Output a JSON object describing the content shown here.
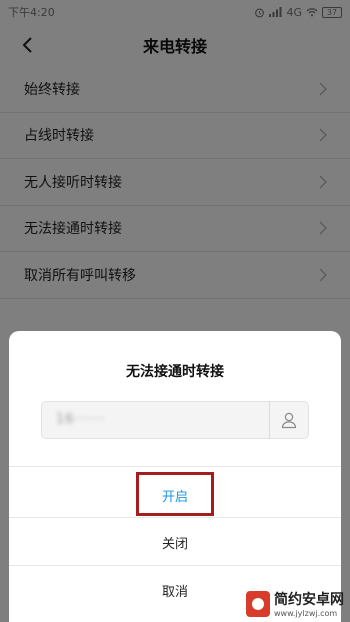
{
  "statusbar": {
    "time": "下午4:20",
    "signal": "4G",
    "battery": "37"
  },
  "header": {
    "title": "来电转接"
  },
  "menu": {
    "items": [
      {
        "label": "始终转接"
      },
      {
        "label": "占线时转接"
      },
      {
        "label": "无人接听时转接"
      },
      {
        "label": "无法接通时转接"
      },
      {
        "label": "取消所有呼叫转移"
      }
    ]
  },
  "dialog": {
    "title": "无法接通时转接",
    "phone_value": "16······",
    "actions": {
      "enable": "开启",
      "disable": "关闭",
      "cancel": "取消"
    },
    "accent_color": "#1696e6",
    "highlight_color": "#a51e1e"
  },
  "watermark": {
    "name": "简约安卓网",
    "url": "www.jylzwj.com"
  }
}
